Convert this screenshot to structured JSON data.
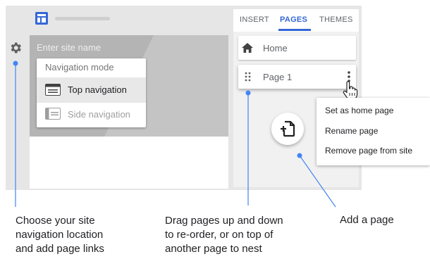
{
  "editor": {
    "site_name_placeholder": "Enter site name"
  },
  "nav_menu": {
    "title": "Navigation mode",
    "options": [
      {
        "label": "Top navigation",
        "selected": true
      },
      {
        "label": "Side navigation",
        "selected": false
      }
    ]
  },
  "panel": {
    "tabs": [
      {
        "label": "INSERT",
        "active": false
      },
      {
        "label": "PAGES",
        "active": true
      },
      {
        "label": "THEMES",
        "active": false
      }
    ],
    "pages": [
      {
        "label": "Home",
        "icon": "home-icon"
      },
      {
        "label": "Page 1",
        "icon": "drag-handle-icon"
      }
    ]
  },
  "context_menu": {
    "items": [
      {
        "label": "Set as home page"
      },
      {
        "label": "Rename page"
      },
      {
        "label": "Remove page from site"
      }
    ]
  },
  "callouts": {
    "left": [
      "Choose your site",
      "navigation location",
      "and add page links"
    ],
    "middle": [
      "Drag pages up and down",
      "to re-order, or on top of",
      "another page to nest"
    ],
    "right": [
      "Add a page"
    ]
  },
  "colors": {
    "accent": "#3367d6",
    "callout_line": "#4285f4",
    "hero_gray": "#b4b4b4"
  }
}
